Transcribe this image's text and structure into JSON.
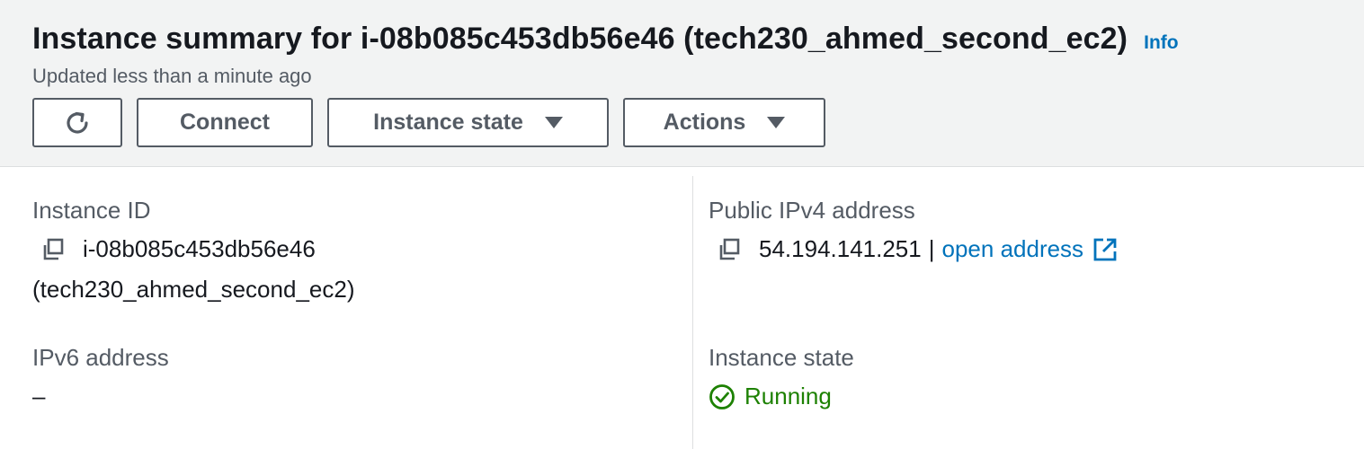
{
  "header": {
    "title": "Instance summary for i-08b085c453db56e46 (tech230_ahmed_second_ec2)",
    "info_label": "Info",
    "updated": "Updated less than a minute ago"
  },
  "toolbar": {
    "refresh_icon": "refresh-icon",
    "connect_label": "Connect",
    "instance_state_label": "Instance state",
    "actions_label": "Actions"
  },
  "fields": {
    "instance_id": {
      "label": "Instance ID",
      "value": "i-08b085c453db56e46",
      "name": "(tech230_ahmed_second_ec2)"
    },
    "public_ipv4": {
      "label": "Public IPv4 address",
      "value": "54.194.141.251",
      "separator": "|",
      "link_label": "open address"
    },
    "ipv6": {
      "label": "IPv6 address",
      "value": "–"
    },
    "instance_state": {
      "label": "Instance state",
      "value": "Running"
    }
  },
  "colors": {
    "link": "#0073bb",
    "running": "#1d8102",
    "header_bg": "#f2f3f3",
    "label": "#545b64"
  }
}
